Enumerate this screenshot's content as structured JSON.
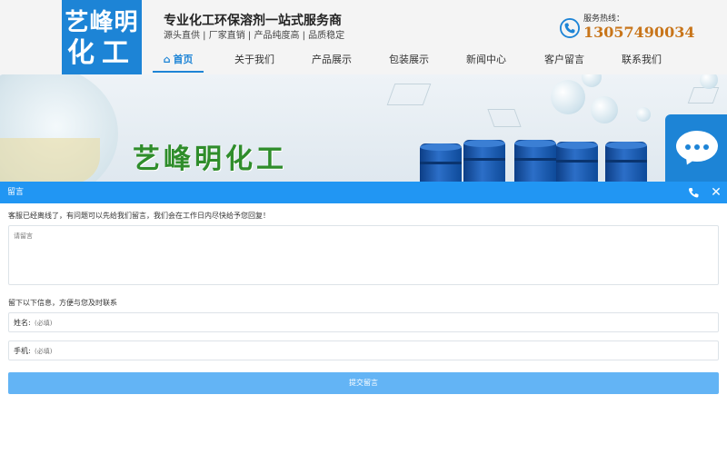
{
  "header": {
    "logo_line1": "艺峰明",
    "logo_line2": "化工",
    "slogan": "专业化工环保溶剂一站式服务商",
    "tagline": "源头直供 | 厂家直销 | 产品纯度高 | 品质稳定",
    "hotline_label": "服务热线：",
    "hotline_number": "13057490034",
    "hotline_icon": "phone-icon"
  },
  "nav": {
    "items": [
      {
        "label": "首页",
        "active": true
      },
      {
        "label": "关于我们",
        "active": false
      },
      {
        "label": "产品展示",
        "active": false
      },
      {
        "label": "包装展示",
        "active": false
      },
      {
        "label": "新闻中心",
        "active": false
      },
      {
        "label": "客户留言",
        "active": false
      },
      {
        "label": "联系我们",
        "active": false
      }
    ]
  },
  "banner": {
    "title": "艺峰明化工"
  },
  "float_chat": {
    "icon": "chat-bubble-icon"
  },
  "message_panel": {
    "title": "留言",
    "intro": "客服已经离线了，有问题可以先给我们留言，我们会在工作日内尽快给予您回复！",
    "message_placeholder": "请留言",
    "contact_hint": "留下以下信息，方便与您及时联系",
    "name_label": "姓名:",
    "name_placeholder": "(必填)",
    "phone_label": "手机:",
    "phone_placeholder": "(必填)",
    "submit_label": "提交留言"
  },
  "colors": {
    "brand_blue": "#1d84d6",
    "panel_bar": "#2196f3",
    "submit_button": "#63b4f5",
    "hotline": "#c8751a",
    "banner_title": "#2f8d2b"
  }
}
